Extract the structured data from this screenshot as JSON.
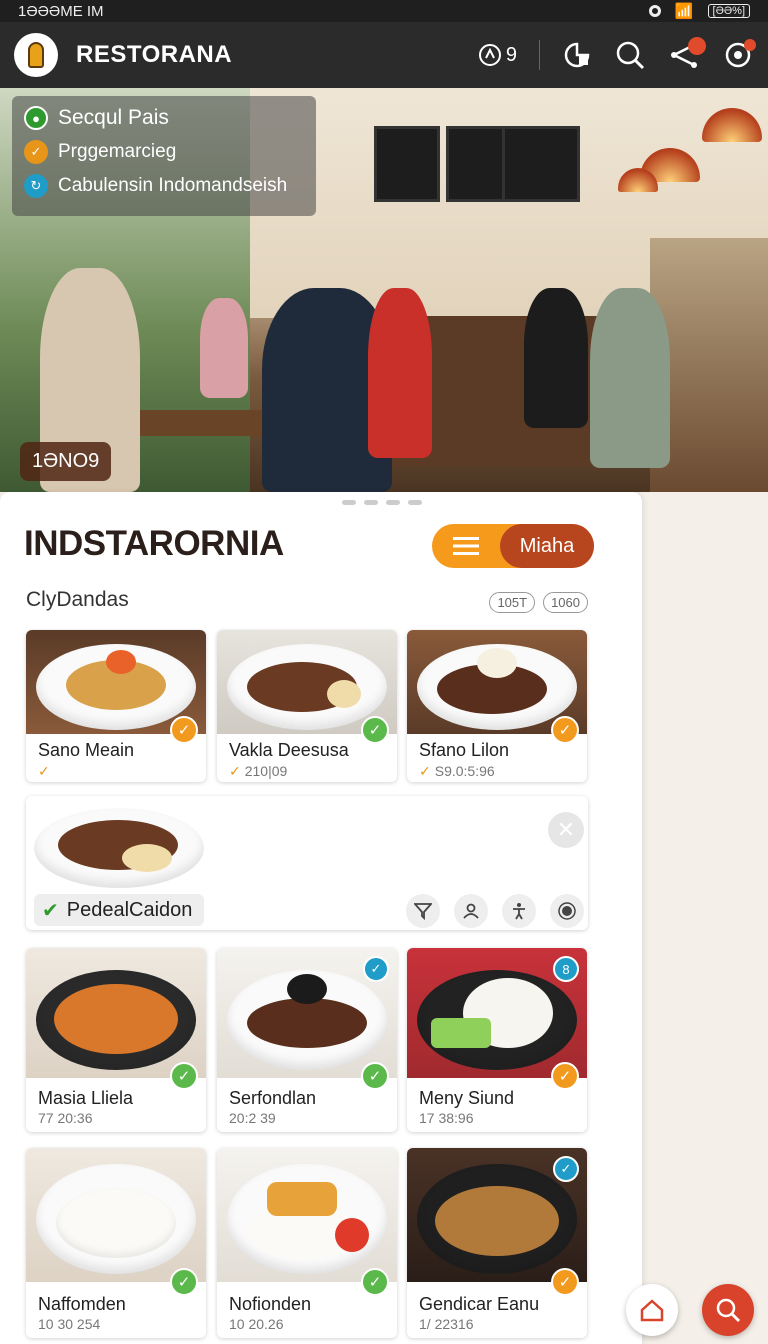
{
  "status_bar": {
    "time": "1ƏƏƏME IM",
    "battery": "[ƏƏ%]"
  },
  "header": {
    "title": "RESTORANA",
    "count": "9"
  },
  "hero": {
    "overlay": {
      "title": "Secqul Pais",
      "line1": "Prggemarcieg",
      "line2": "Cabulensin Indomandseish"
    },
    "tag": "1ƏNO9"
  },
  "sheet": {
    "title": "INDSTARORNIA",
    "toggle_label": "Miaha",
    "section_label": "ClyDandas",
    "chips": [
      "105T",
      "1060"
    ]
  },
  "cards_row1": [
    {
      "name": "Sano Meain",
      "sub": "",
      "check_color": "#f29a1e"
    },
    {
      "name": "Vakla Deesusa",
      "sub": "210|09",
      "check_color": "#5bb84a"
    },
    {
      "name": "Sfano Lilon",
      "sub": "S9.0:5:96",
      "check_color": "#f29a1e"
    }
  ],
  "featured": {
    "label": "PedealCaidon"
  },
  "cards_row2": [
    {
      "name": "Masia Lliela",
      "sub": "77 20:36",
      "check_color": "#5bb84a"
    },
    {
      "name": "Serfondlan",
      "sub": "20:2 39",
      "check_color": "#5bb84a"
    },
    {
      "name": "Meny Siund",
      "sub": "17 38:96",
      "check_color": "#f29a1e"
    }
  ],
  "cards_row3": [
    {
      "name": "Naffomden",
      "sub": "10 30 254",
      "check_color": "#5bb84a"
    },
    {
      "name": "Nofionden",
      "sub": "10 20.26",
      "check_color": "#5bb84a"
    },
    {
      "name": "Gendicar Eanu",
      "sub": "1/ 22316",
      "check_color": "#f29a1e"
    }
  ],
  "icons": {
    "header": [
      "chart-icon",
      "search-icon",
      "share-icon",
      "settings-icon"
    ],
    "fabs": [
      "home-icon",
      "search-icon"
    ]
  },
  "colors": {
    "accent": "#f59a1b",
    "brand": "#b7461f",
    "fab_search": "#d9432b"
  }
}
